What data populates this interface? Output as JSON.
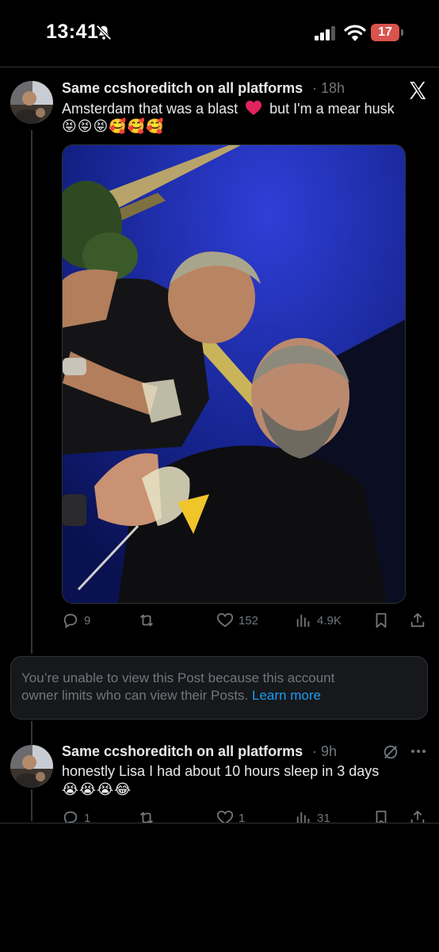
{
  "status_bar": {
    "time": "13:41",
    "battery": "17"
  },
  "posts": [
    {
      "author": "Same ccshoreditch on all platforms",
      "age": "· 18h",
      "text_part1": "Amsterdam that was a blast",
      "text_part2": "but I'm a mear husk",
      "emojis": "😝😝😝🥰🥰🥰",
      "actions": {
        "replies": "9",
        "likes": "152",
        "views": "4.9K"
      }
    },
    {
      "author": "Same ccshoreditch on all platforms",
      "age": "· 9h",
      "text": "honestly Lisa I had about 10 hours sleep in 3 days",
      "emojis": "😭😭😭😂",
      "actions": {
        "replies": "1",
        "likes": "1",
        "views": "31"
      }
    }
  ],
  "restricted_notice": {
    "line1": "You’re unable to view this Post because this account",
    "line2": "owner limits who can view their Posts.",
    "link": "Learn more"
  },
  "icons": {
    "status": [
      "bell-slash-icon",
      "signal-icon",
      "wifi-icon",
      "battery-icon"
    ],
    "post": [
      "x-logo-icon",
      "reply-icon",
      "repost-icon",
      "like-icon",
      "views-icon",
      "bookmark-icon",
      "share-icon",
      "grok-icon",
      "more-icon"
    ]
  },
  "colors": {
    "background": "#000000",
    "link": "#1d9bf0",
    "muted": "#71767b",
    "heart": "#e0245e",
    "battery": "#d9534f"
  }
}
